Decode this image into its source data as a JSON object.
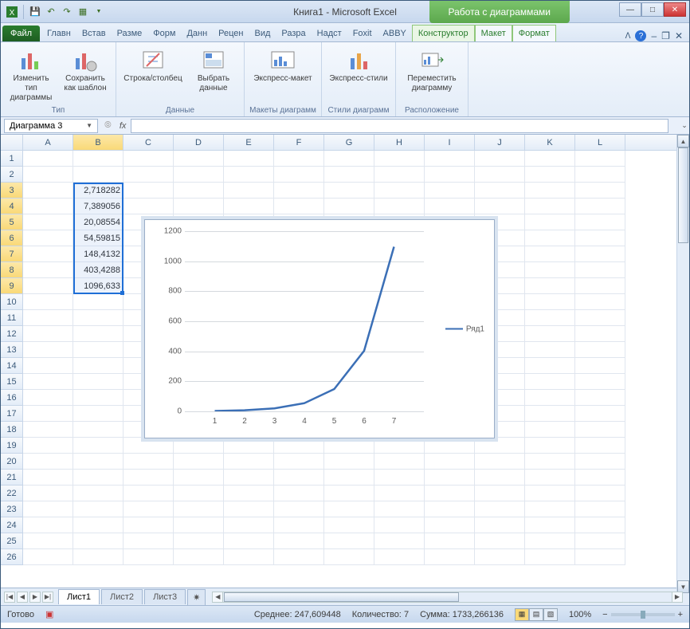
{
  "title": {
    "doc": "Книга1",
    "sep": " - ",
    "app": "Microsoft Excel"
  },
  "chart_tools_label": "Работа с диаграммами",
  "tabs": {
    "file": "Файл",
    "items": [
      "Главн",
      "Встав",
      "Разме",
      "Форм",
      "Данн",
      "Рецен",
      "Вид",
      "Разра",
      "Надст",
      "Foxit",
      "ABBY"
    ],
    "tool": [
      "Конструктор",
      "Макет",
      "Формат"
    ]
  },
  "ribbon": {
    "g1": {
      "label": "Тип",
      "btn1": "Изменить тип диаграммы",
      "btn2": "Сохранить как шаблон"
    },
    "g2": {
      "label": "Данные",
      "btn1": "Строка/столбец",
      "btn2": "Выбрать данные"
    },
    "g3": {
      "label": "Макеты диаграмм",
      "btn1": "Экспресс-макет"
    },
    "g4": {
      "label": "Стили диаграмм",
      "btn1": "Экспресс-стили"
    },
    "g5": {
      "label": "Расположение",
      "btn1": "Переместить диаграмму"
    }
  },
  "namebox": "Диаграмма 3",
  "fx": "fx",
  "columns": [
    "A",
    "B",
    "C",
    "D",
    "E",
    "F",
    "G",
    "H",
    "I",
    "J",
    "K",
    "L"
  ],
  "cell_values": {
    "b3": "2,718282",
    "b4": "7,389056",
    "b5": "20,08554",
    "b6": "54,59815",
    "b7": "148,4132",
    "b8": "403,4288",
    "b9": "1096,633"
  },
  "chart_data": {
    "type": "line",
    "categories": [
      1,
      2,
      3,
      4,
      5,
      6,
      7
    ],
    "series": [
      {
        "name": "Ряд1",
        "values": [
          2.718282,
          7.389056,
          20.08554,
          54.59815,
          148.4132,
          403.4288,
          1096.633
        ]
      }
    ],
    "ylim": [
      0,
      1200
    ],
    "yticks": [
      0,
      200,
      400,
      600,
      800,
      1000,
      1200
    ],
    "xlabel": "",
    "ylabel": "",
    "title": ""
  },
  "legend_label": "Ряд1",
  "sheets": {
    "active": "Лист1",
    "others": [
      "Лист2",
      "Лист3"
    ]
  },
  "status": {
    "ready": "Готово",
    "avg_label": "Среднее:",
    "avg": "247,609448",
    "count_label": "Количество:",
    "count": "7",
    "sum_label": "Сумма:",
    "sum": "1733,266136",
    "zoom": "100%"
  }
}
